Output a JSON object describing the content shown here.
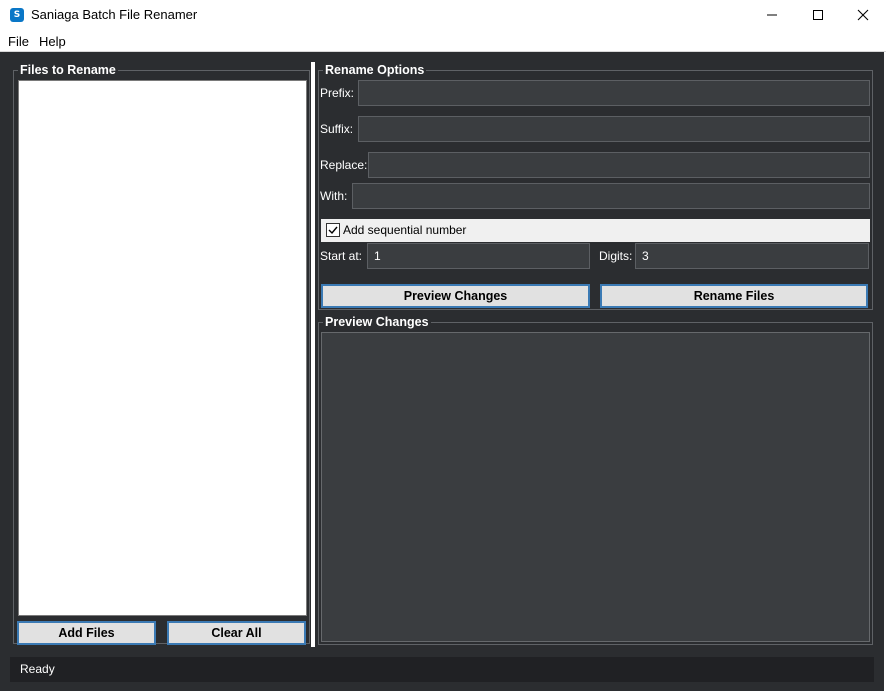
{
  "window": {
    "title": "Saniaga Batch File Renamer",
    "icon_letter": "S"
  },
  "menu": {
    "file": "File",
    "help": "Help"
  },
  "files_frame": {
    "title": "Files to Rename",
    "add_button": "Add Files",
    "clear_button": "Clear All"
  },
  "options": {
    "title": "Rename Options",
    "prefix_label": "Prefix:",
    "prefix_value": "",
    "suffix_label": "Suffix:",
    "suffix_value": "",
    "replace_label": "Replace:",
    "replace_value": "",
    "with_label": "With:",
    "with_value": "",
    "sequential_label": "Add sequential number",
    "sequential_checked": true,
    "start_label": "Start at:",
    "start_value": "1",
    "digits_label": "Digits:",
    "digits_value": "3",
    "preview_button": "Preview Changes",
    "rename_button": "Rename Files"
  },
  "preview": {
    "title": "Preview Changes"
  },
  "status": {
    "text": "Ready"
  },
  "colors": {
    "background": "#2b2d30",
    "entry": "#3a3d40",
    "button_border": "#3b7ab4",
    "status_bar": "#202124"
  },
  "icons": [
    "app-icon",
    "minimize-icon",
    "maximize-icon",
    "close-icon",
    "checkmark-icon"
  ]
}
